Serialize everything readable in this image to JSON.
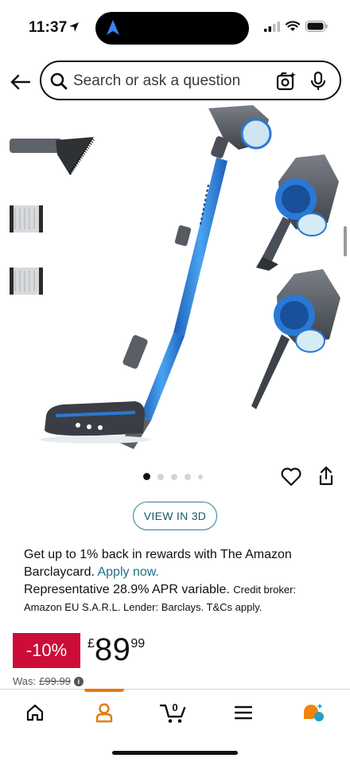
{
  "status_bar": {
    "time": "11:37"
  },
  "search": {
    "placeholder": "Search or ask a question"
  },
  "gallery": {
    "thumbnails": [
      "nozzle-attachment",
      "filter-1",
      "filter-2"
    ],
    "page_count": 5,
    "active_page": 1
  },
  "buttons": {
    "view_3d": "VIEW IN 3D"
  },
  "rewards": {
    "line1": "Get up to 1% back in rewards with The Amazon Barclaycard.",
    "apply_link": "Apply now.",
    "apr": "Representative 28.9% APR variable.",
    "credit_info": "Credit broker: Amazon EU S.A.R.L. Lender: Barclays. T&Cs apply."
  },
  "price": {
    "discount": "-10%",
    "currency": "£",
    "whole": "89",
    "fraction": "99",
    "was_label": "Was:",
    "was_price": "£99.99"
  },
  "bottom_nav": {
    "items": [
      "home",
      "account",
      "cart",
      "menu",
      "rufus"
    ],
    "active": "account",
    "cart_count": "0"
  },
  "colors": {
    "discount_bg": "#cc0c39",
    "link": "#1e6f83",
    "nav_active": "#e47911",
    "vacuum_blue": "#2a78d6"
  }
}
